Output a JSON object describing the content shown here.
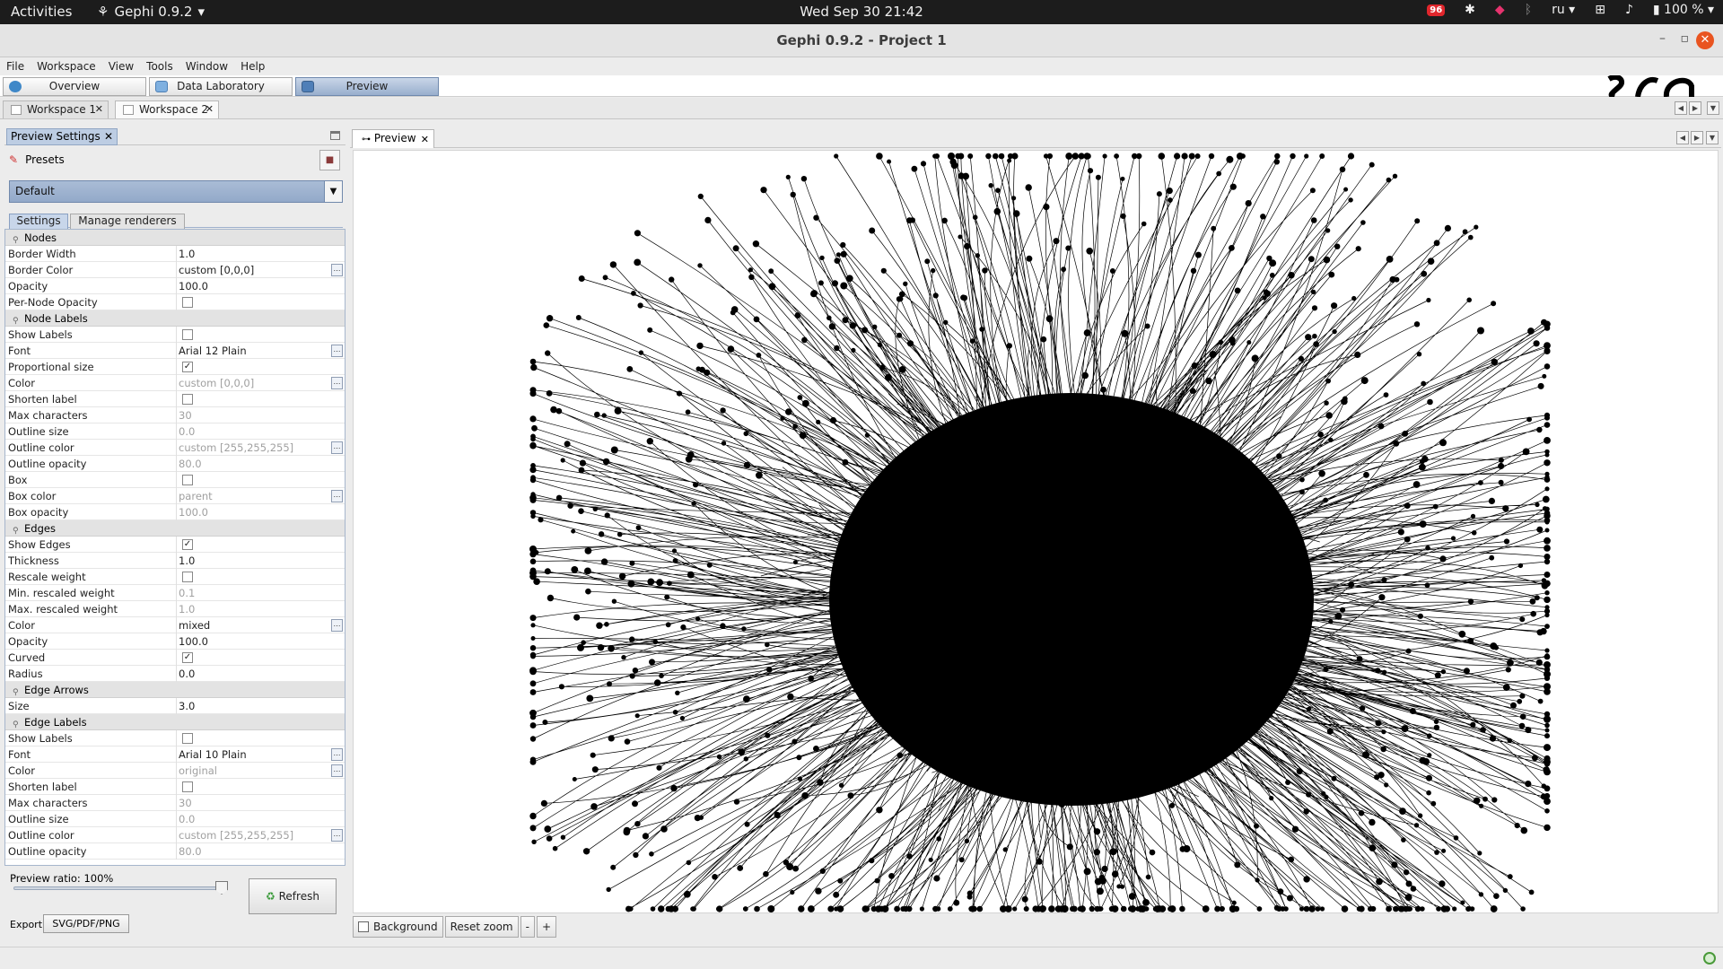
{
  "system": {
    "activities": "Activities",
    "app_menu": "Gephi 0.9.2",
    "clock": "Wed Sep 30  21:42",
    "badge": "96",
    "keyboard_layout": "ru",
    "battery": "100 %"
  },
  "window": {
    "title": "Gephi 0.9.2 - Project 1"
  },
  "menu": [
    "File",
    "Workspace",
    "View",
    "Tools",
    "Window",
    "Help"
  ],
  "perspectives": [
    {
      "label": "Overview",
      "active": false
    },
    {
      "label": "Data Laboratory",
      "active": false
    },
    {
      "label": "Preview",
      "active": true
    }
  ],
  "workspaces": [
    {
      "label": "Workspace 1",
      "active": false
    },
    {
      "label": "Workspace 2",
      "active": true
    }
  ],
  "preview_settings": {
    "panel_title": "Preview Settings",
    "presets_label": "Presets",
    "preset_value": "Default",
    "tabs": [
      "Settings",
      "Manage renderers"
    ],
    "categories": [
      {
        "name": "Nodes",
        "rows": [
          {
            "label": "Border Width",
            "value": "1.0"
          },
          {
            "label": "Border Color",
            "value": "custom [0,0,0]",
            "button": true
          },
          {
            "label": "Opacity",
            "value": "100.0"
          },
          {
            "label": "Per-Node Opacity",
            "checkbox": true,
            "checked": false
          }
        ]
      },
      {
        "name": "Node Labels",
        "rows": [
          {
            "label": "Show Labels",
            "checkbox": true,
            "checked": false
          },
          {
            "label": "Font",
            "value": "Arial 12 Plain",
            "button": true
          },
          {
            "label": "Proportional size",
            "checkbox": true,
            "checked": true
          },
          {
            "label": "Color",
            "value": "custom [0,0,0]",
            "disabled": true,
            "button": true
          },
          {
            "label": "Shorten label",
            "checkbox": true,
            "checked": false
          },
          {
            "label": "Max characters",
            "value": "30",
            "disabled": true
          },
          {
            "label": "Outline size",
            "value": "0.0",
            "disabled": true
          },
          {
            "label": "Outline color",
            "value": "custom [255,255,255]",
            "disabled": true,
            "button": true
          },
          {
            "label": "Outline opacity",
            "value": "80.0",
            "disabled": true
          },
          {
            "label": "Box",
            "checkbox": true,
            "checked": false
          },
          {
            "label": "Box color",
            "value": "parent",
            "disabled": true,
            "button": true
          },
          {
            "label": "Box opacity",
            "value": "100.0",
            "disabled": true
          }
        ]
      },
      {
        "name": "Edges",
        "rows": [
          {
            "label": "Show Edges",
            "checkbox": true,
            "checked": true
          },
          {
            "label": "Thickness",
            "value": "1.0"
          },
          {
            "label": "Rescale weight",
            "checkbox": true,
            "checked": false
          },
          {
            "label": "Min. rescaled weight",
            "value": "0.1",
            "disabled": true
          },
          {
            "label": "Max. rescaled weight",
            "value": "1.0",
            "disabled": true
          },
          {
            "label": "Color",
            "value": "mixed",
            "button": true
          },
          {
            "label": "Opacity",
            "value": "100.0"
          },
          {
            "label": "Curved",
            "checkbox": true,
            "checked": true
          },
          {
            "label": "Radius",
            "value": "0.0"
          }
        ]
      },
      {
        "name": "Edge Arrows",
        "rows": [
          {
            "label": "Size",
            "value": "3.0"
          }
        ]
      },
      {
        "name": "Edge Labels",
        "rows": [
          {
            "label": "Show Labels",
            "checkbox": true,
            "checked": false
          },
          {
            "label": "Font",
            "value": "Arial 10 Plain",
            "button": true
          },
          {
            "label": "Color",
            "value": "original",
            "disabled": true,
            "button": true
          },
          {
            "label": "Shorten label",
            "checkbox": true,
            "checked": false
          },
          {
            "label": "Max characters",
            "value": "30",
            "disabled": true
          },
          {
            "label": "Outline size",
            "value": "0.0",
            "disabled": true
          },
          {
            "label": "Outline color",
            "value": "custom [255,255,255]",
            "disabled": true,
            "button": true
          },
          {
            "label": "Outline opacity",
            "value": "80.0",
            "disabled": true
          }
        ]
      }
    ],
    "preview_ratio_label": "Preview ratio: 100%",
    "preview_ratio": 1.0,
    "refresh_label": "Refresh",
    "export_label": "Export:",
    "export_button": "SVG/PDF/PNG"
  },
  "preview": {
    "tab_label": "Preview",
    "background_label": "Background",
    "reset_zoom_label": "Reset zoom",
    "zoom_out_label": "-",
    "zoom_in_label": "+"
  }
}
